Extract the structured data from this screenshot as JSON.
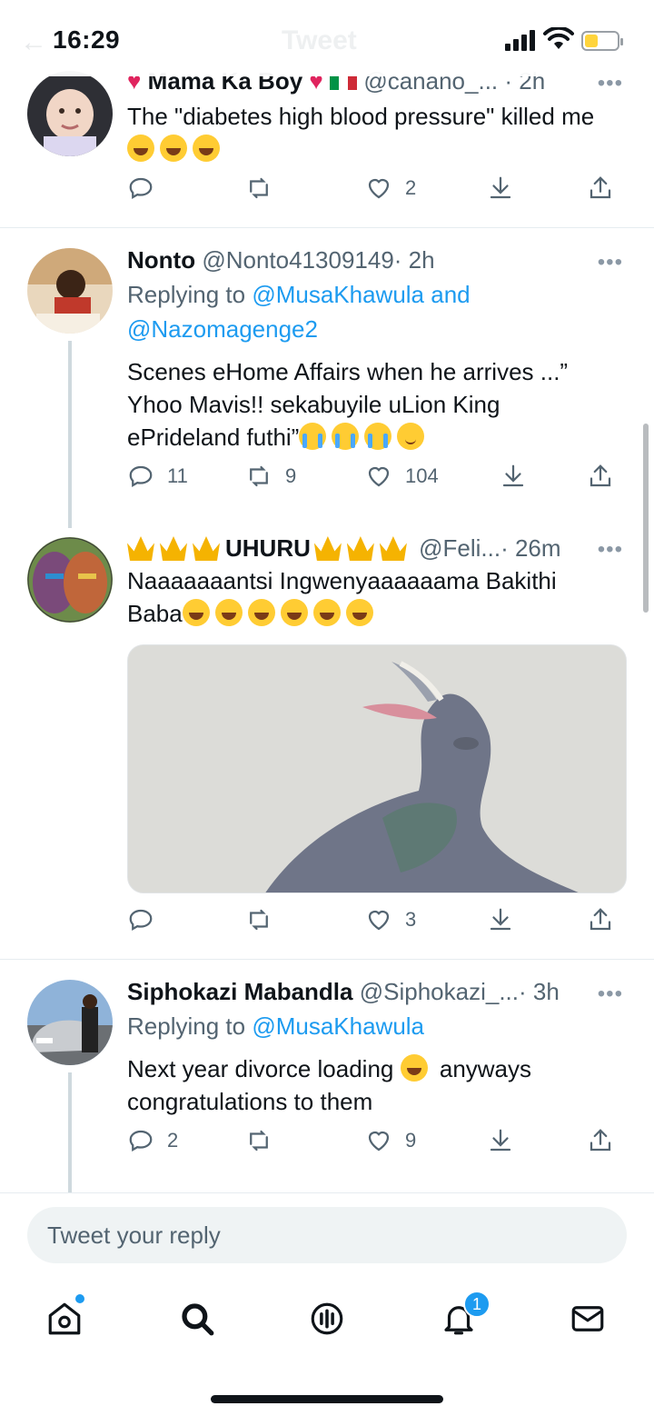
{
  "status_bar": {
    "time": "16:29",
    "ghost_title": "Tweet"
  },
  "tweets": [
    {
      "name": "Mama Ka Boy",
      "handle": "@canano_...",
      "time": "· 2h",
      "text": "The \"diabetes high blood pressure\" killed me",
      "emojis": [
        "rolling-laugh",
        "rolling-laugh",
        "rolling-laugh"
      ],
      "counts": {
        "reply": "",
        "retweet": "",
        "like": "2"
      }
    },
    {
      "name": "Nonto",
      "handle": "@Nonto41309149",
      "time": "· 2h",
      "replying_prefix": "Replying to",
      "mention_1": "@MusaKhawula",
      "mention_join": "and",
      "mention_2": "@Nazomagenge2",
      "text_line1": "Scenes eHome Affairs when he arrives ...”",
      "text_line2": "Yhoo Mavis!! sekabuyile uLion King",
      "text_line3": "ePrideland futhi”",
      "counts": {
        "reply": "11",
        "retweet": "9",
        "like": "104"
      }
    },
    {
      "name": "UHURU",
      "handle": "@Feli...",
      "time": "· 26m",
      "text_line1": "Naaaaaaantsi Ingwenyaaaaaama Bakithi",
      "text_line2": "Baba",
      "counts": {
        "reply": "",
        "retweet": "",
        "like": "3"
      }
    },
    {
      "name": "Siphokazi Mabandla",
      "handle": "@Siphokazi_...",
      "time": "· 3h",
      "replying_prefix": "Replying to",
      "mention_1": "@MusaKhawula",
      "text_line1a": "Next year divorce loading",
      "text_line1b": "anyways",
      "text_line2": "congratulations to them",
      "counts": {
        "reply": "2",
        "retweet": "",
        "like": "9"
      }
    }
  ],
  "reply_box": {
    "placeholder": "Tweet your reply"
  },
  "tabbar": {
    "notification_count": "1"
  },
  "colors": {
    "accent": "#1d9bf0",
    "muted": "#536471",
    "text": "#0f1419"
  }
}
